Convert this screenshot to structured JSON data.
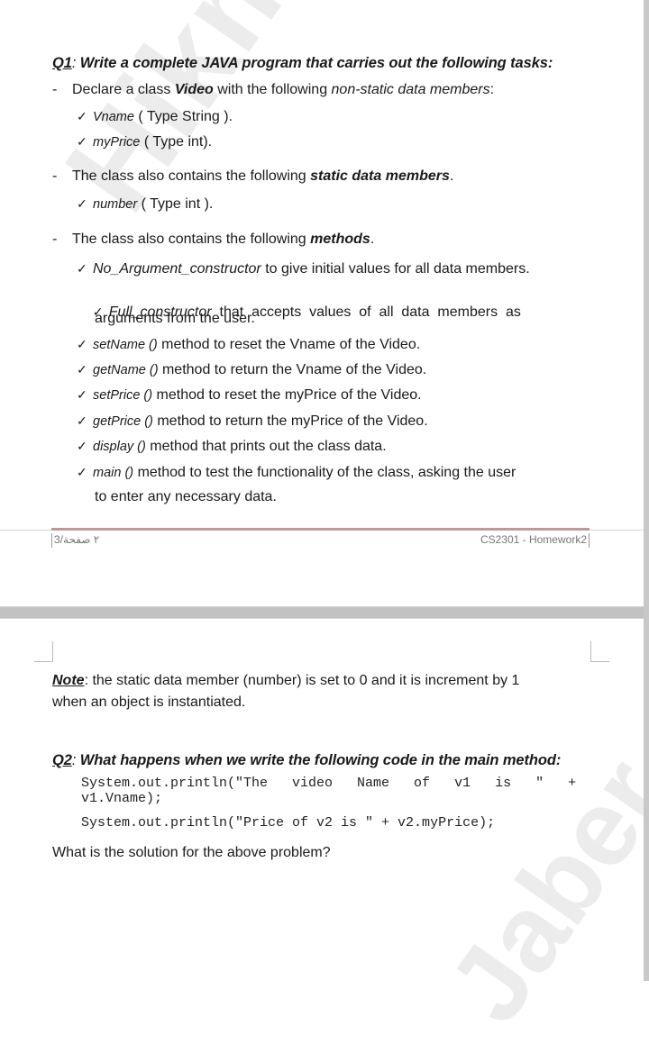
{
  "page1": {
    "q1": {
      "number": "Q1",
      "title": " Write a complete JAVA program that carries out the following tasks:"
    },
    "bullets": [
      {
        "pre": "Declare a class ",
        "emph": "Video",
        "post": " with the following ",
        "emph2": "non-static data members",
        "end": ":"
      },
      {
        "pre": "The class also contains the following ",
        "emph": "static data members",
        "end": "."
      },
      {
        "pre": "The class also contains the following ",
        "emph": "methods",
        "end": "."
      }
    ],
    "non_static_members": [
      {
        "name": "Vname",
        "type": "( Type  String )."
      },
      {
        "name": "myPrice",
        "type": "( Type  int)."
      }
    ],
    "static_members": [
      {
        "name": "number",
        "type": "( Type int )."
      }
    ],
    "methods": [
      {
        "name": "No_Argument_constructor",
        "desc": " to give initial values for all data members."
      },
      {
        "name": "Full_constructor",
        "desc": "  that  accepts  values  of  all  data  members  as",
        "cont": "arguments from the user."
      },
      {
        "name": "setName ()",
        "desc": " method to reset the Vname of the Video."
      },
      {
        "name": "getName ()",
        "desc": " method to return the Vname of the Video."
      },
      {
        "name": "setPrice ()",
        "desc": " method to reset the myPrice of the Video."
      },
      {
        "name": "getPrice ()",
        "desc": " method to return the myPrice of the Video."
      },
      {
        "name": "display ()",
        "desc": " method that prints out the class data."
      },
      {
        "name": "main ()",
        "desc": " method to test the functionality of the class, asking the user",
        "cont": "to enter any necessary data."
      }
    ],
    "footer": {
      "left": "3/٢ صفحة",
      "right": "CS2301 - Homework2"
    }
  },
  "page2": {
    "note": {
      "label": "Note",
      "text1": ": the static data member (number) is set to 0 and it is increment by 1",
      "text2": "when an object is instantiated."
    },
    "q2": {
      "number": "Q2",
      "title": " What happens when we write the following code in the main method:"
    },
    "code": [
      "System.out.println(\"The   video   Name   of   v1   is   \"   +",
      "v1.Vname);",
      "System.out.println(\"Price of v2 is \" + v2.myPrice);"
    ],
    "question": "What is the solution for the above problem?"
  },
  "watermarks": [
    "Hikmat Jaber",
    "Jaber"
  ]
}
